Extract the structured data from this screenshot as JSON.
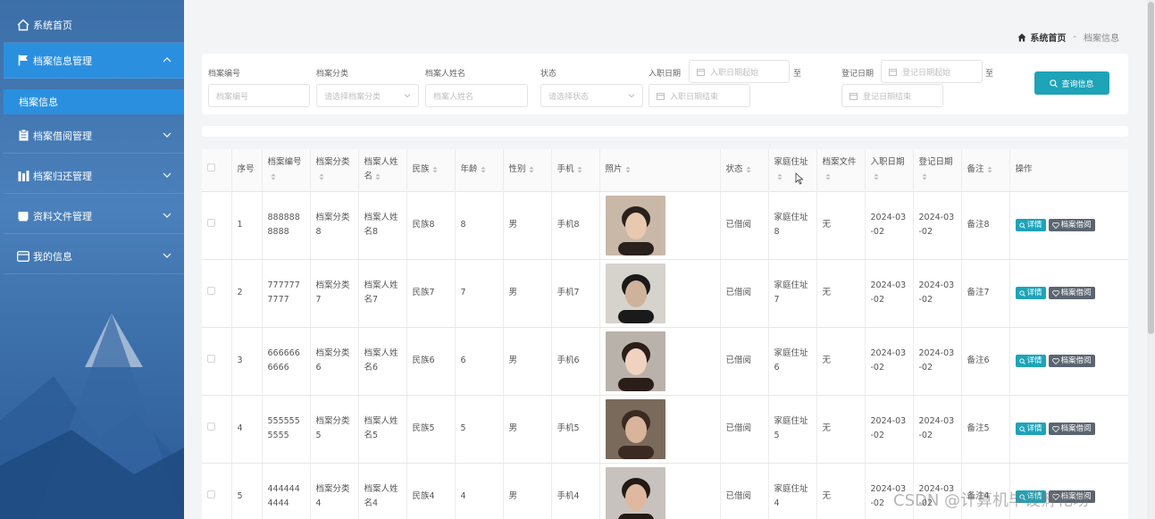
{
  "sidebar": {
    "items": [
      {
        "label": "系统首页",
        "icon": "home-icon"
      },
      {
        "label": "档案信息管理",
        "icon": "flag-icon"
      },
      {
        "label": "档案借阅管理",
        "icon": "clipboard-icon"
      },
      {
        "label": "档案归还管理",
        "icon": "bar-icon"
      },
      {
        "label": "资料文件管理",
        "icon": "book-icon"
      },
      {
        "label": "我的信息",
        "icon": "card-icon"
      }
    ],
    "sub_item": "档案信息"
  },
  "breadcrumb": {
    "home": "系统首页",
    "separator": "-",
    "current": "档案信息"
  },
  "search": {
    "fields": [
      {
        "label": "档案编号",
        "placeholder": "档案编号"
      },
      {
        "label": "档案分类",
        "placeholder": "请选择档案分类"
      },
      {
        "label": "档案人姓名",
        "placeholder": "档案人姓名"
      },
      {
        "label": "状态",
        "placeholder": "请选择状态"
      }
    ],
    "hire_date": {
      "label": "入职日期",
      "start": "入职日期起始",
      "to": "至",
      "end": "入职日期结束"
    },
    "reg_date": {
      "label": "登记日期",
      "start": "登记日期起始",
      "to": "至",
      "end": "登记日期结束"
    },
    "button": "查询信息"
  },
  "table": {
    "headers": [
      "序号",
      "档案编号",
      "档案分类",
      "档案人姓名",
      "民族",
      "年龄",
      "性别",
      "手机",
      "照片",
      "状态",
      "家庭住址",
      "档案文件",
      "入职日期",
      "登记日期",
      "备注",
      "操作"
    ],
    "rows": [
      {
        "idx": "1",
        "code": "8888888888",
        "cat": "档案分类8",
        "name": "档案人姓名8",
        "nation": "民族8",
        "age": "8",
        "sex": "男",
        "phone": "手机8",
        "status": "已借阅",
        "addr": "家庭住址8",
        "file": "无",
        "hire": "2024-03-02",
        "reg": "2024-03-02",
        "note": "备注8"
      },
      {
        "idx": "2",
        "code": "7777777777",
        "cat": "档案分类7",
        "name": "档案人姓名7",
        "nation": "民族7",
        "age": "7",
        "sex": "男",
        "phone": "手机7",
        "status": "已借阅",
        "addr": "家庭住址7",
        "file": "无",
        "hire": "2024-03-02",
        "reg": "2024-03-02",
        "note": "备注7"
      },
      {
        "idx": "3",
        "code": "6666666666",
        "cat": "档案分类6",
        "name": "档案人姓名6",
        "nation": "民族6",
        "age": "6",
        "sex": "男",
        "phone": "手机6",
        "status": "已借阅",
        "addr": "家庭住址6",
        "file": "无",
        "hire": "2024-03-02",
        "reg": "2024-03-02",
        "note": "备注6"
      },
      {
        "idx": "4",
        "code": "5555555555",
        "cat": "档案分类5",
        "name": "档案人姓名5",
        "nation": "民族5",
        "age": "5",
        "sex": "男",
        "phone": "手机5",
        "status": "已借阅",
        "addr": "家庭住址5",
        "file": "无",
        "hire": "2024-03-02",
        "reg": "2024-03-02",
        "note": "备注5"
      },
      {
        "idx": "5",
        "code": "4444444444",
        "cat": "档案分类4",
        "name": "档案人姓名4",
        "nation": "民族4",
        "age": "4",
        "sex": "男",
        "phone": "手机4",
        "status": "已借阅",
        "addr": "家庭住址4",
        "file": "无",
        "hire": "2024-03-02",
        "reg": "2024-03-02",
        "note": "备注4"
      }
    ],
    "detail_label": "详情",
    "borrow_label": "档案借阅"
  },
  "watermark": "CSDN @计算机毕设孵化场",
  "colors": {
    "sidebar": "#3c6fa8",
    "active": "#2b8fe0",
    "primary": "#1ea3b8",
    "secondary": "#5b6570"
  }
}
